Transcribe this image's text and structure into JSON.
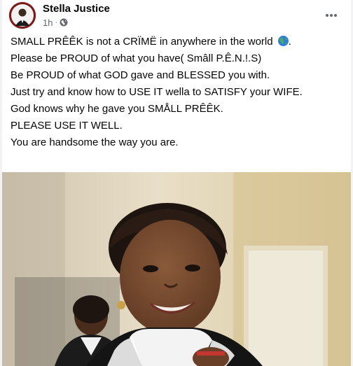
{
  "post": {
    "author": "Stella Justice",
    "time": "1h",
    "separator": "·",
    "privacy_icon": "public-globe-icon",
    "more_icon": "more-options-icon",
    "lines": [
      "SMALL PRÊÊK is not a CRÏMË in anywhere in the world",
      "Please be PROUD of what you have( Smâll P.Ê.N.!.S)",
      "Be PROUD of what GOD gave and BLESSED you with.",
      "Just try and know how to USE IT wella to SATISFY your WIFE.",
      "God knows why he gave you SMÅLL PRÊÊK.",
      "PLEASE USE IT WELL.",
      "You are handsome the way you are."
    ],
    "emoji_icon": "earth-globe-emoji-icon",
    "emoji_suffix": "."
  },
  "colors": {
    "background": "#f0f2f5",
    "card": "#ffffff",
    "text": "#050505",
    "secondary_text": "#65676b"
  }
}
